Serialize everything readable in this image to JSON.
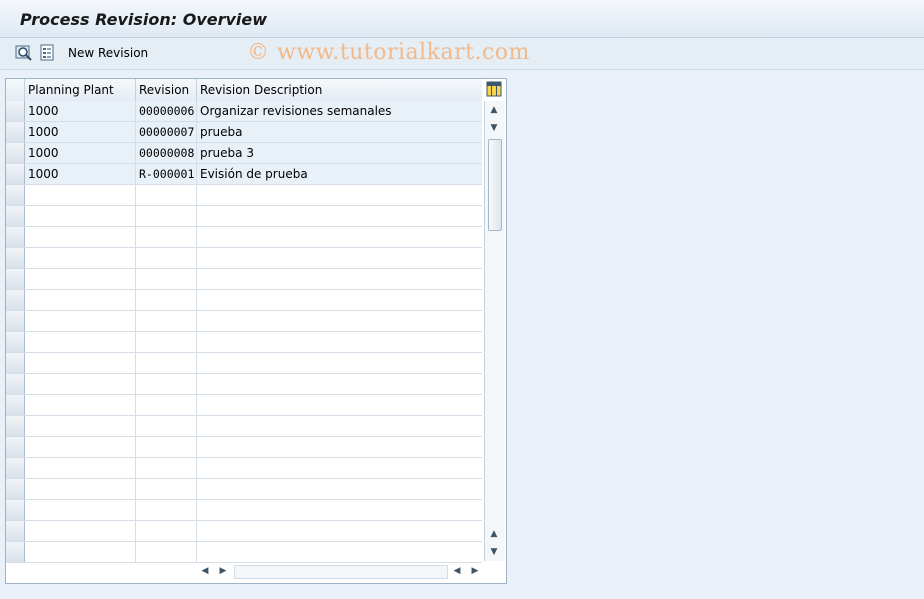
{
  "title": "Process Revision: Overview",
  "toolbar": {
    "icons": [
      "find-icon",
      "details-icon"
    ],
    "new_revision_label": "New Revision"
  },
  "watermark": "© www.tutorialkart.com",
  "table": {
    "columns": [
      "Planning Plant",
      "Revision",
      "Revision Description"
    ],
    "rows": [
      [
        "1000",
        "00000006",
        "Organizar revisiones semanales"
      ],
      [
        "1000",
        "00000007",
        "prueba"
      ],
      [
        "1000",
        "00000008",
        "prueba 3"
      ],
      [
        "1000",
        "R-000001",
        "Evisión de prueba"
      ]
    ],
    "empty_rows": 18
  },
  "colors": {
    "background": "#e9f0f7",
    "row_filled": "#e8f1f8",
    "watermark": "#f2b98a"
  }
}
